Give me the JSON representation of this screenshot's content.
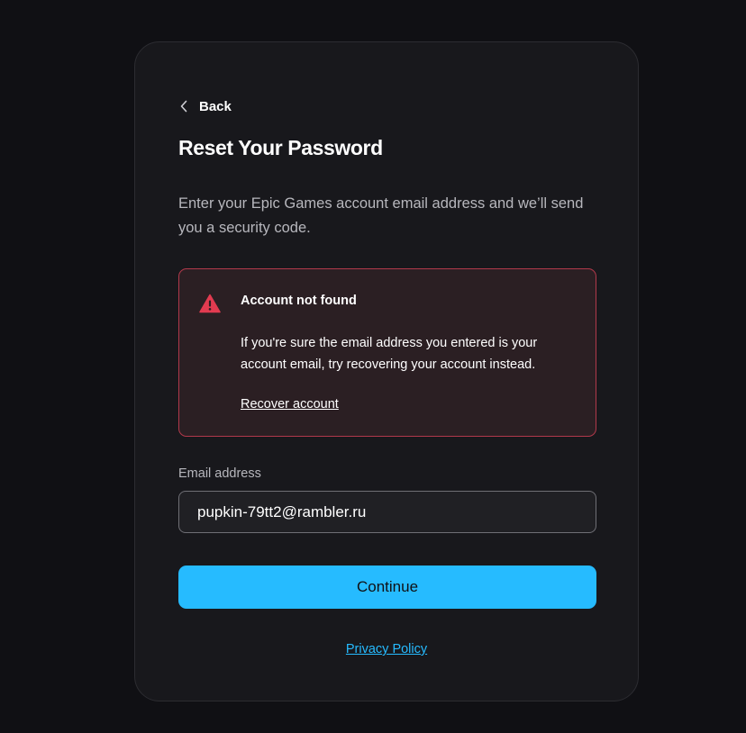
{
  "nav": {
    "back_label": "Back"
  },
  "page": {
    "title": "Reset Your Password",
    "description": "Enter your Epic Games account email address and we’ll send you a security code."
  },
  "alert": {
    "icon": "warning-triangle-icon",
    "title": "Account not found",
    "body": "If you're sure the email address you entered is your account email, try recovering your account instead.",
    "link_label": "Recover account"
  },
  "form": {
    "email_label": "Email address",
    "email_value": "pupkin-79tt2@rambler.ru",
    "continue_label": "Continue"
  },
  "footer": {
    "privacy_label": "Privacy Policy"
  },
  "colors": {
    "background": "#101014",
    "card": "#18181c",
    "accent": "#26bbff",
    "error_border": "#b1394b",
    "error_icon": "#e23b50"
  }
}
